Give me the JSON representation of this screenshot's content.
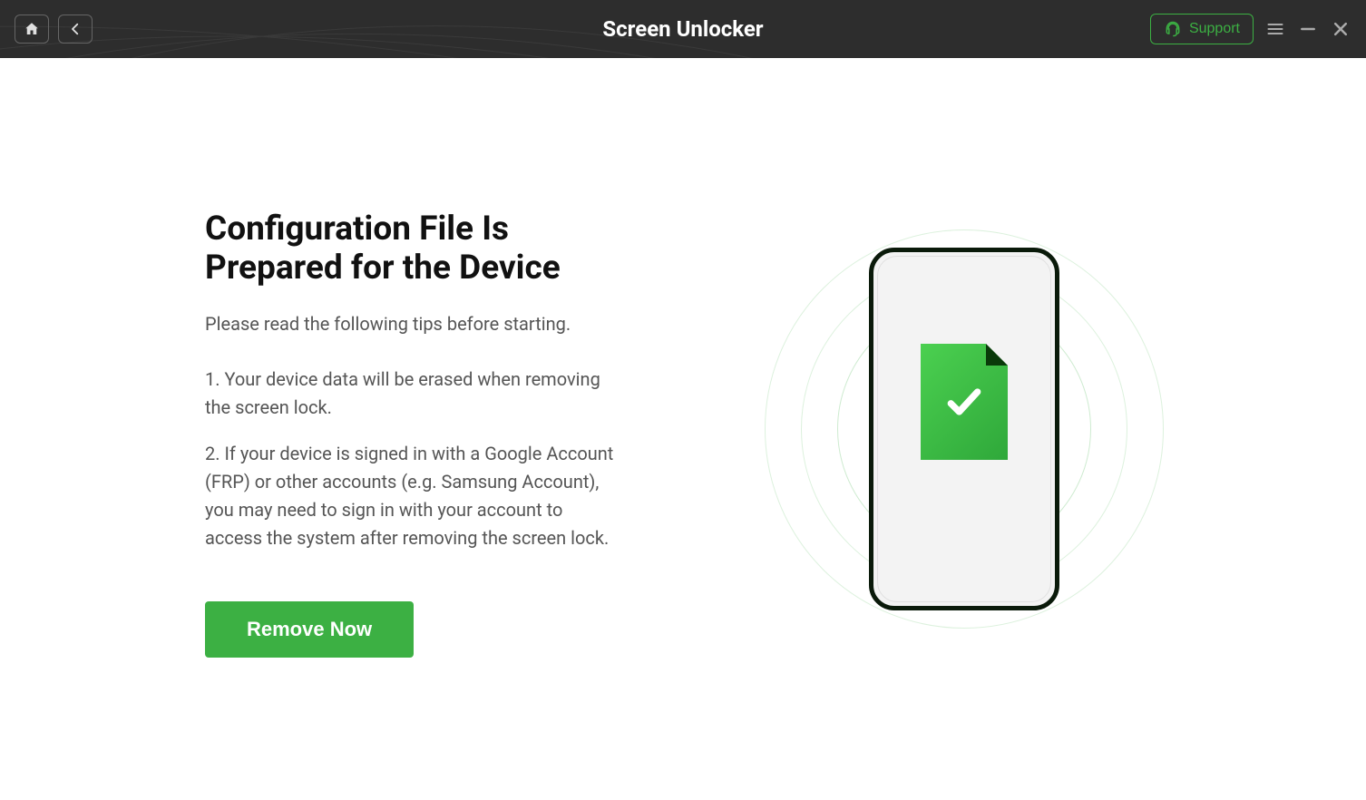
{
  "header": {
    "title": "Screen Unlocker",
    "support_label": "Support"
  },
  "main": {
    "heading": "Configuration File Is Prepared for the Device",
    "subtitle": "Please read the following tips before starting.",
    "tips": [
      "1. Your device data will be erased when removing the screen lock.",
      "2. If your device is signed in with a Google Account (FRP) or other accounts (e.g. Samsung Account), you may need to sign in with your account to access the system after removing the screen lock."
    ],
    "action_label": "Remove Now"
  },
  "colors": {
    "accent": "#3cb043",
    "titlebar_bg": "#2d2d2d"
  }
}
